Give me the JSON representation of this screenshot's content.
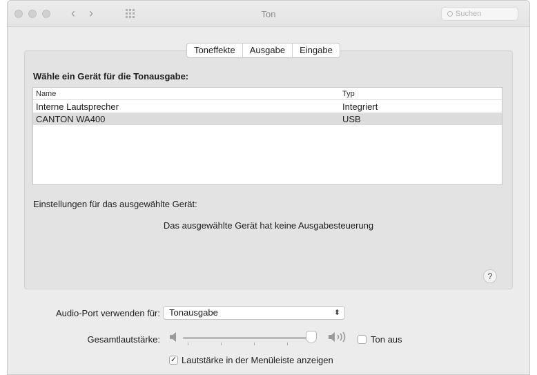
{
  "window": {
    "title": "Ton",
    "search_placeholder": "Suchen"
  },
  "tabs": [
    {
      "label": "Toneffekte"
    },
    {
      "label": "Ausgabe",
      "selected": true
    },
    {
      "label": "Eingabe"
    }
  ],
  "output": {
    "section_title": "Wähle ein Gerät für die Tonausgabe:",
    "columns": {
      "name": "Name",
      "type": "Typ"
    },
    "devices": [
      {
        "name": "Interne Lautsprecher",
        "type": "Integriert",
        "selected": false
      },
      {
        "name": "CANTON WA400",
        "type": "USB",
        "selected": true
      }
    ],
    "settings_label": "Einstellungen für das ausgewählte Gerät:",
    "no_control_message": "Das ausgewählte Gerät hat keine Ausgabesteuerung"
  },
  "help_label": "?",
  "audio_port": {
    "label": "Audio-Port verwenden für:",
    "value": "Tonausgabe"
  },
  "volume": {
    "label": "Gesamtlautstärke:",
    "level": 0.97,
    "mute_label": "Ton aus",
    "muted": false
  },
  "menubar_option": {
    "label": "Lautstärke in der Menüleiste anzeigen",
    "checked": true
  },
  "icons": {
    "back": "chevron-left-icon",
    "forward": "chevron-right-icon",
    "grid": "grid-icon",
    "search": "search-icon",
    "speaker_low": "speaker-low-icon",
    "speaker_high": "speaker-high-icon",
    "select_chevron": "up-down-chevron-icon",
    "check": "checkmark-icon"
  }
}
